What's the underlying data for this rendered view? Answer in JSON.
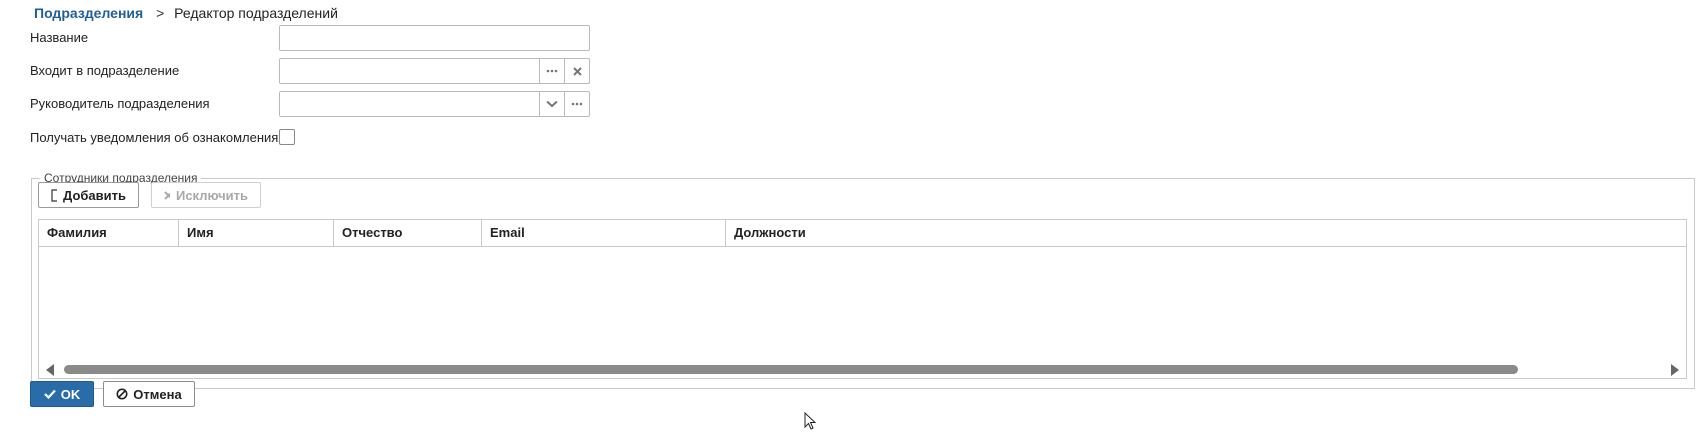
{
  "breadcrumb": {
    "parent": "Подразделения",
    "separator": ">",
    "current": "Редактор подразделений"
  },
  "form": {
    "name_label": "Название",
    "name_value": "",
    "parent_label": "Входит в подразделение",
    "parent_value": "",
    "head_label": "Руководитель подразделения",
    "head_value": "",
    "notify_label": "Получать уведомления об ознакомлениях",
    "notify_checked": false
  },
  "employees": {
    "legend": "Сотрудники подразделения",
    "add_label": "Добавить",
    "exclude_label": "Исключить",
    "columns": [
      "Фамилия",
      "Имя",
      "Отчество",
      "Email",
      "Должности"
    ],
    "rows": []
  },
  "footer": {
    "ok_label": "OK",
    "cancel_label": "Отмена"
  },
  "icons": {
    "ellipsis": "ellipsis-icon",
    "clear": "clear-x-icon",
    "dropdown": "chevron-down-icon",
    "add": "document-icon",
    "exclude": "x-icon",
    "ok": "checkmark-icon",
    "cancel": "cancel-circle-icon"
  },
  "colors": {
    "link": "#1f5f96",
    "primary_button": "#2a6ca8",
    "border": "#b9b9b9",
    "scroll_thumb": "#8a8a8a"
  }
}
